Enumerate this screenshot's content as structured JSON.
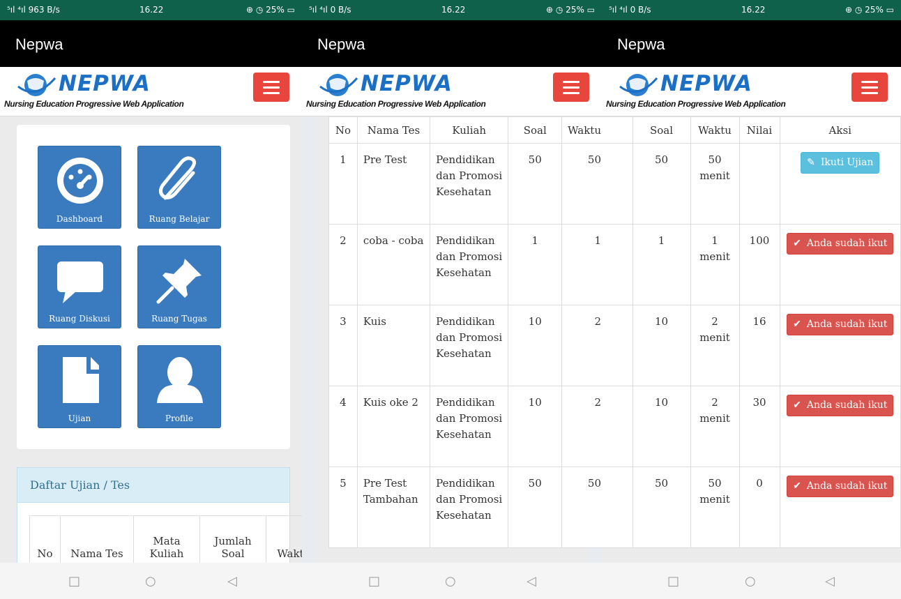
{
  "status": [
    {
      "signal": "⁵ıl ⁴ıl 963 B/s",
      "time": "16.22",
      "right": "⊕ ◷ 25% ▭"
    },
    {
      "signal": "⁵ıl ⁴ıl 0 B/s",
      "time": "16.22",
      "right": "⊕ ◷ 25% ▭"
    },
    {
      "signal": "⁵ıl ⁴ıl 0 B/s",
      "time": "16.22",
      "right": "⊕ ◷ 25% ▭"
    }
  ],
  "app_title": "Nepwa",
  "logo": {
    "name": "NEPWA",
    "tagline": "Nursing Education Progressive Web Application"
  },
  "menu": {
    "tiles": [
      {
        "label": "Dashboard",
        "icon": "dashboard-icon"
      },
      {
        "label": "Ruang Belajar",
        "icon": "paperclip-icon"
      },
      {
        "label": "Ruang Diskusi",
        "icon": "chat-bubble-icon"
      },
      {
        "label": "Ruang Tugas",
        "icon": "pushpin-icon"
      },
      {
        "label": "Ujian",
        "icon": "file-icon"
      },
      {
        "label": "Profile",
        "icon": "user-icon"
      }
    ]
  },
  "exam_panel": {
    "title": "Daftar Ujian / Tes",
    "headers": [
      "No",
      "Nama Tes",
      "Mata Kuliah",
      "Jumlah Soal",
      "Wakt"
    ]
  },
  "table": {
    "headers": [
      "No",
      "Nama Tes",
      "Kuliah",
      "Soal",
      "Waktu",
      "Nilai",
      "Aksi"
    ],
    "rows": [
      {
        "no": "1",
        "nama": "Pre Test",
        "kuliah": "Pendidikan dan Promosi Kesehatan",
        "soal": "50",
        "waktu_num": "50",
        "waktu": "50 menit",
        "nilai": "",
        "aksi": "Ikuti Ujian",
        "aksi_type": "info"
      },
      {
        "no": "2",
        "nama": "coba - coba",
        "kuliah": "Pendidikan dan Promosi Kesehatan",
        "soal": "1",
        "waktu_num": "1",
        "waktu": "1 menit",
        "nilai": "100",
        "aksi": "Anda sudah ikut",
        "aksi_type": "done"
      },
      {
        "no": "3",
        "nama": "Kuis",
        "kuliah": "Pendidikan dan Promosi Kesehatan",
        "soal": "10",
        "waktu_num": "2",
        "waktu": "2 menit",
        "nilai": "16",
        "aksi": "Anda sudah ikut",
        "aksi_type": "done"
      },
      {
        "no": "4",
        "nama": "Kuis oke 2",
        "kuliah": "Pendidikan dan Promosi Kesehatan",
        "soal": "10",
        "waktu_num": "2",
        "waktu": "2 menit",
        "nilai": "30",
        "aksi": "Anda sudah ikut",
        "aksi_type": "done"
      },
      {
        "no": "5",
        "nama": "Pre Test Tambahan",
        "kuliah": "Pendidikan dan Promosi Kesehatan",
        "soal": "50",
        "waktu_num": "50",
        "waktu": "50 menit",
        "nilai": "0",
        "aksi": "Anda sudah ikut",
        "aksi_type": "done"
      }
    ]
  },
  "android_nav": {
    "square": "□",
    "circle": "○",
    "back": "◁"
  },
  "colors": {
    "status_bar": "#10614b",
    "accent_blue": "#3a7bbf",
    "burger_red": "#e8453c",
    "info": "#5bc0de",
    "danger": "#d9534f"
  }
}
